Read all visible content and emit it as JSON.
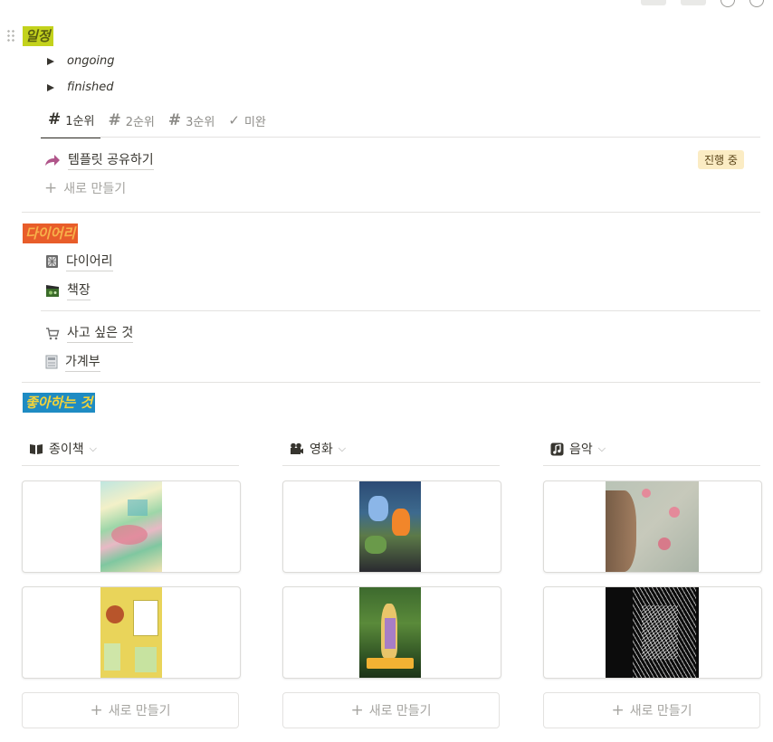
{
  "schedule": {
    "title": "일정",
    "toggles": [
      "ongoing",
      "finished"
    ],
    "tabs": [
      {
        "label": "1순위",
        "icon": "hash"
      },
      {
        "label": "2순위",
        "icon": "hash"
      },
      {
        "label": "3순위",
        "icon": "hash"
      },
      {
        "label": "미완",
        "icon": "check"
      }
    ],
    "active_tab": "1순위",
    "item": {
      "label": "템플릿 공유하기",
      "status": "진행 중",
      "icon": "share-arrow-icon"
    },
    "new_label": "새로 만들기"
  },
  "diary": {
    "title": "다이어리",
    "group1": [
      {
        "label": "다이어리",
        "icon": "notebook-icon"
      },
      {
        "label": "책장",
        "icon": "clapper-icon"
      }
    ],
    "group2": [
      {
        "label": "사고 싶은 것",
        "icon": "cart-icon"
      },
      {
        "label": "가계부",
        "icon": "ledger-icon"
      }
    ]
  },
  "likes": {
    "title": "좋아하는 것",
    "galleries": [
      {
        "name": "종이책",
        "icon": "book-icon",
        "new_label": "새로 만들기"
      },
      {
        "name": "영화",
        "icon": "camera-icon",
        "new_label": "새로 만들기"
      },
      {
        "name": "음악",
        "icon": "music-icon",
        "new_label": "새로 만들기"
      }
    ]
  },
  "colors": {
    "highlight_green": "#c3d21c",
    "highlight_orange": "#e85d2a",
    "highlight_blue": "#1e8bc3",
    "badge_bg": "#fbecc4"
  }
}
